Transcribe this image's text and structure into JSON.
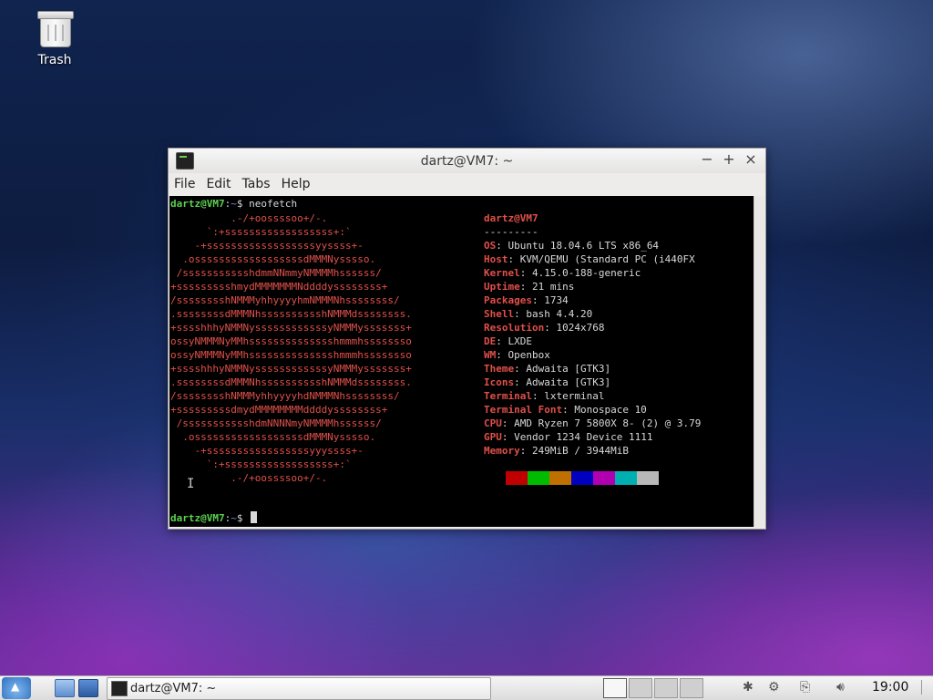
{
  "desktop": {
    "icons": [
      {
        "label": "Trash",
        "icon": "trash-icon"
      }
    ]
  },
  "window": {
    "title": "dartz@VM7: ~",
    "controls": {
      "minimize": "−",
      "maximize": "+",
      "close": "×"
    },
    "menu": [
      "File",
      "Edit",
      "Tabs",
      "Help"
    ]
  },
  "terminal": {
    "prompt": {
      "user": "dartz@VM7",
      "sep": ":",
      "path": "~",
      "symbol": "$"
    },
    "command": "neofetch",
    "ascii_lines": [
      "          .-/+oossssoo+/-.",
      "      `:+ssssssssssssssssss+:`",
      "    -+ssssssssssssssssssyyssss+-",
      "  .ossssssssssssssssssdMMMNysssso.",
      " /ssssssssssshdmmNNmmyNMMMMhssssss/",
      "+ssssssssshmydMMMMMMMNddddyssssssss+",
      "/sssssssshNMMMyhhyyyyhmNMMMNhssssssss/",
      ".ssssssssdMMMNhsssssssssshNMMMdssssssss.",
      "+sssshhhyNMMNyssssssssssssyNMMMysssssss+",
      "ossyNMMMNyMMhsssssssssssssshmmmhssssssso",
      "ossyNMMMNyMMhsssssssssssssshmmmhssssssso",
      "+sssshhhyNMMNyssssssssssssyNMMMysssssss+",
      ".ssssssssdMMMNhsssssssssshNMMMdssssssss.",
      "/sssssssshNMMMyhhyyyyhdNMMMNhssssssss/",
      "+sssssssssdmydMMMMMMMMddddyssssssss+",
      " /ssssssssssshdmNNNNmyNMMMMhssssss/",
      "  .ossssssssssssssssssdMMMNysssso.",
      "    -+sssssssssssssssssyyyssss+-",
      "      `:+ssssssssssssssssss+:`",
      "          .-/+oossssoo+/-."
    ],
    "header": "dartz@VM7",
    "separator": "---------",
    "info": [
      {
        "key": "OS",
        "value": "Ubuntu 18.04.6 LTS x86_64"
      },
      {
        "key": "Host",
        "value": "KVM/QEMU (Standard PC (i440FX"
      },
      {
        "key": "Kernel",
        "value": "4.15.0-188-generic"
      },
      {
        "key": "Uptime",
        "value": "21 mins"
      },
      {
        "key": "Packages",
        "value": "1734"
      },
      {
        "key": "Shell",
        "value": "bash 4.4.20"
      },
      {
        "key": "Resolution",
        "value": "1024x768"
      },
      {
        "key": "DE",
        "value": "LXDE"
      },
      {
        "key": "WM",
        "value": "Openbox"
      },
      {
        "key": "Theme",
        "value": "Adwaita [GTK3]"
      },
      {
        "key": "Icons",
        "value": "Adwaita [GTK3]"
      },
      {
        "key": "Terminal",
        "value": "lxterminal"
      },
      {
        "key": "Terminal Font",
        "value": "Monospace 10"
      },
      {
        "key": "CPU",
        "value": "AMD Ryzen 7 5800X 8- (2) @ 3.79"
      },
      {
        "key": "GPU",
        "value": "Vendor 1234 Device 1111"
      },
      {
        "key": "Memory",
        "value": "249MiB / 3944MiB"
      }
    ],
    "palette": [
      "#c00000",
      "#00bb00",
      "#c07000",
      "#0000c0",
      "#b000b0",
      "#00b0b0",
      "#b8b8b8"
    ]
  },
  "taskbar": {
    "task_label": "dartz@VM7: ~",
    "clock": "19:00",
    "desktops": 4,
    "active_desktop": 0
  }
}
